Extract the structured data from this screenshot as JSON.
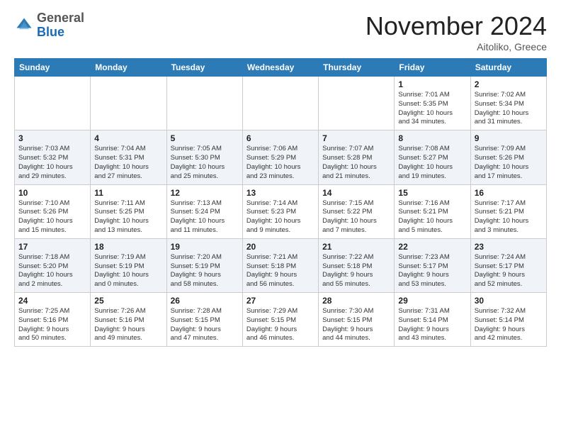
{
  "header": {
    "logo_general": "General",
    "logo_blue": "Blue",
    "month_title": "November 2024",
    "location": "Aitoliko, Greece"
  },
  "weekdays": [
    "Sunday",
    "Monday",
    "Tuesday",
    "Wednesday",
    "Thursday",
    "Friday",
    "Saturday"
  ],
  "weeks": [
    [
      {
        "day": "",
        "info": ""
      },
      {
        "day": "",
        "info": ""
      },
      {
        "day": "",
        "info": ""
      },
      {
        "day": "",
        "info": ""
      },
      {
        "day": "",
        "info": ""
      },
      {
        "day": "1",
        "info": "Sunrise: 7:01 AM\nSunset: 5:35 PM\nDaylight: 10 hours\nand 34 minutes."
      },
      {
        "day": "2",
        "info": "Sunrise: 7:02 AM\nSunset: 5:34 PM\nDaylight: 10 hours\nand 31 minutes."
      }
    ],
    [
      {
        "day": "3",
        "info": "Sunrise: 7:03 AM\nSunset: 5:32 PM\nDaylight: 10 hours\nand 29 minutes."
      },
      {
        "day": "4",
        "info": "Sunrise: 7:04 AM\nSunset: 5:31 PM\nDaylight: 10 hours\nand 27 minutes."
      },
      {
        "day": "5",
        "info": "Sunrise: 7:05 AM\nSunset: 5:30 PM\nDaylight: 10 hours\nand 25 minutes."
      },
      {
        "day": "6",
        "info": "Sunrise: 7:06 AM\nSunset: 5:29 PM\nDaylight: 10 hours\nand 23 minutes."
      },
      {
        "day": "7",
        "info": "Sunrise: 7:07 AM\nSunset: 5:28 PM\nDaylight: 10 hours\nand 21 minutes."
      },
      {
        "day": "8",
        "info": "Sunrise: 7:08 AM\nSunset: 5:27 PM\nDaylight: 10 hours\nand 19 minutes."
      },
      {
        "day": "9",
        "info": "Sunrise: 7:09 AM\nSunset: 5:26 PM\nDaylight: 10 hours\nand 17 minutes."
      }
    ],
    [
      {
        "day": "10",
        "info": "Sunrise: 7:10 AM\nSunset: 5:26 PM\nDaylight: 10 hours\nand 15 minutes."
      },
      {
        "day": "11",
        "info": "Sunrise: 7:11 AM\nSunset: 5:25 PM\nDaylight: 10 hours\nand 13 minutes."
      },
      {
        "day": "12",
        "info": "Sunrise: 7:13 AM\nSunset: 5:24 PM\nDaylight: 10 hours\nand 11 minutes."
      },
      {
        "day": "13",
        "info": "Sunrise: 7:14 AM\nSunset: 5:23 PM\nDaylight: 10 hours\nand 9 minutes."
      },
      {
        "day": "14",
        "info": "Sunrise: 7:15 AM\nSunset: 5:22 PM\nDaylight: 10 hours\nand 7 minutes."
      },
      {
        "day": "15",
        "info": "Sunrise: 7:16 AM\nSunset: 5:21 PM\nDaylight: 10 hours\nand 5 minutes."
      },
      {
        "day": "16",
        "info": "Sunrise: 7:17 AM\nSunset: 5:21 PM\nDaylight: 10 hours\nand 3 minutes."
      }
    ],
    [
      {
        "day": "17",
        "info": "Sunrise: 7:18 AM\nSunset: 5:20 PM\nDaylight: 10 hours\nand 2 minutes."
      },
      {
        "day": "18",
        "info": "Sunrise: 7:19 AM\nSunset: 5:19 PM\nDaylight: 10 hours\nand 0 minutes."
      },
      {
        "day": "19",
        "info": "Sunrise: 7:20 AM\nSunset: 5:19 PM\nDaylight: 9 hours\nand 58 minutes."
      },
      {
        "day": "20",
        "info": "Sunrise: 7:21 AM\nSunset: 5:18 PM\nDaylight: 9 hours\nand 56 minutes."
      },
      {
        "day": "21",
        "info": "Sunrise: 7:22 AM\nSunset: 5:18 PM\nDaylight: 9 hours\nand 55 minutes."
      },
      {
        "day": "22",
        "info": "Sunrise: 7:23 AM\nSunset: 5:17 PM\nDaylight: 9 hours\nand 53 minutes."
      },
      {
        "day": "23",
        "info": "Sunrise: 7:24 AM\nSunset: 5:17 PM\nDaylight: 9 hours\nand 52 minutes."
      }
    ],
    [
      {
        "day": "24",
        "info": "Sunrise: 7:25 AM\nSunset: 5:16 PM\nDaylight: 9 hours\nand 50 minutes."
      },
      {
        "day": "25",
        "info": "Sunrise: 7:26 AM\nSunset: 5:16 PM\nDaylight: 9 hours\nand 49 minutes."
      },
      {
        "day": "26",
        "info": "Sunrise: 7:28 AM\nSunset: 5:15 PM\nDaylight: 9 hours\nand 47 minutes."
      },
      {
        "day": "27",
        "info": "Sunrise: 7:29 AM\nSunset: 5:15 PM\nDaylight: 9 hours\nand 46 minutes."
      },
      {
        "day": "28",
        "info": "Sunrise: 7:30 AM\nSunset: 5:15 PM\nDaylight: 9 hours\nand 44 minutes."
      },
      {
        "day": "29",
        "info": "Sunrise: 7:31 AM\nSunset: 5:14 PM\nDaylight: 9 hours\nand 43 minutes."
      },
      {
        "day": "30",
        "info": "Sunrise: 7:32 AM\nSunset: 5:14 PM\nDaylight: 9 hours\nand 42 minutes."
      }
    ]
  ]
}
